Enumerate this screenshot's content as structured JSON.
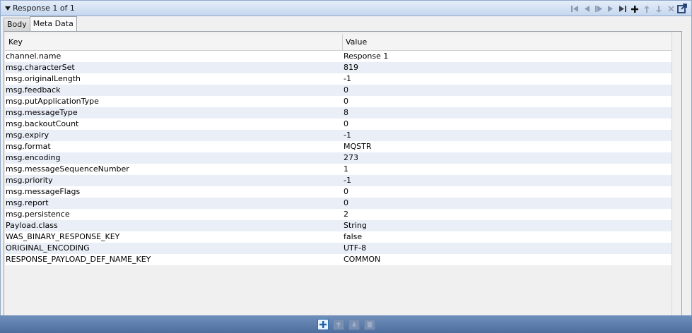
{
  "window": {
    "title": "Response 1 of 1"
  },
  "tabs": [
    {
      "label": "Body",
      "active": false
    },
    {
      "label": "Meta Data",
      "active": true
    }
  ],
  "table": {
    "headers": {
      "key": "Key",
      "value": "Value"
    },
    "rows": [
      {
        "key": "channel.name",
        "value": "Response 1"
      },
      {
        "key": "msg.characterSet",
        "value": "819"
      },
      {
        "key": "msg.originalLength",
        "value": "-1"
      },
      {
        "key": "msg.feedback",
        "value": "0"
      },
      {
        "key": "msg.putApplicationType",
        "value": "0"
      },
      {
        "key": "msg.messageType",
        "value": "8"
      },
      {
        "key": "msg.backoutCount",
        "value": "0"
      },
      {
        "key": "msg.expiry",
        "value": "-1"
      },
      {
        "key": "msg.format",
        "value": "MQSTR"
      },
      {
        "key": "msg.encoding",
        "value": "273"
      },
      {
        "key": "msg.messageSequenceNumber",
        "value": "1"
      },
      {
        "key": "msg.priority",
        "value": "-1"
      },
      {
        "key": "msg.messageFlags",
        "value": "0"
      },
      {
        "key": "msg.report",
        "value": "0"
      },
      {
        "key": "msg.persistence",
        "value": "2"
      },
      {
        "key": "Payload.class",
        "value": "String"
      },
      {
        "key": "WAS_BINARY_RESPONSE_KEY",
        "value": "false"
      },
      {
        "key": "ORIGINAL_ENCODING",
        "value": "UTF-8"
      },
      {
        "key": "RESPONSE_PAYLOAD_DEF_NAME_KEY",
        "value": "COMMON"
      }
    ]
  },
  "toolbar_icons": [
    "first-icon",
    "previous-icon",
    "play-icon",
    "next-icon",
    "last-icon",
    "add-icon",
    "move-up-icon",
    "move-down-icon",
    "delete-icon",
    "popout-icon"
  ],
  "bottom_icons": [
    "add-row-icon",
    "move-row-up-icon",
    "move-row-down-icon",
    "delete-row-icon"
  ],
  "colors": {
    "row_alt": "#e9eef7",
    "bar": "#5a7aa8",
    "accent": "#2e6fb3"
  }
}
